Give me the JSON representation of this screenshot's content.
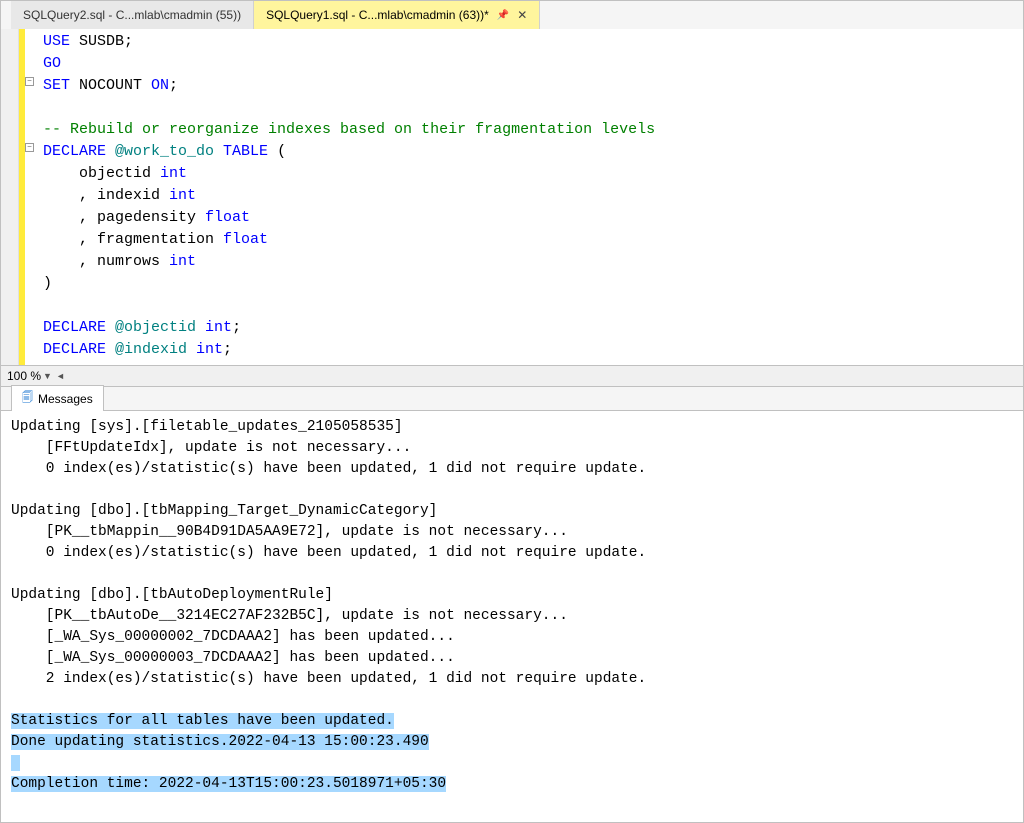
{
  "tabs": {
    "inactive": "SQLQuery2.sql - C...mlab\\cmadmin (55))",
    "active": "SQLQuery1.sql - C...mlab\\cmadmin (63))*"
  },
  "code": {
    "l1a": "USE",
    "l1b": " SUSDB",
    "l1c": ";",
    "l2": "GO",
    "l3a": "SET",
    "l3b": " NOCOUNT ",
    "l3c": "ON",
    "l3d": ";",
    "l5": "-- Rebuild or reorganize indexes based on their fragmentation levels",
    "l6a": "DECLARE",
    "l6b": " @work_to_do ",
    "l6c": "TABLE",
    "l6d": " (",
    "l7a": "    objectid ",
    "l7b": "int",
    "l8a": "    , indexid ",
    "l8b": "int",
    "l9a": "    , pagedensity ",
    "l9b": "float",
    "l10a": "    , fragmentation ",
    "l10b": "float",
    "l11a": "    , numrows ",
    "l11b": "int",
    "l12": ")",
    "l14a": "DECLARE",
    "l14b": " @objectid ",
    "l14c": "int",
    "l14d": ";",
    "l15a": "DECLARE",
    "l15b": " @indexid ",
    "l15c": "int",
    "l15d": ";"
  },
  "zoom": "100 %",
  "messages_tab": "Messages",
  "output": {
    "p1l1": "Updating [sys].[filetable_updates_2105058535]",
    "p1l2": "    [FFtUpdateIdx], update is not necessary...",
    "p1l3": "    0 index(es)/statistic(s) have been updated, 1 did not require update.",
    "p2l1": "Updating [dbo].[tbMapping_Target_DynamicCategory]",
    "p2l2": "    [PK__tbMappin__90B4D91DA5AA9E72], update is not necessary...",
    "p2l3": "    0 index(es)/statistic(s) have been updated, 1 did not require update.",
    "p3l1": "Updating [dbo].[tbAutoDeploymentRule]",
    "p3l2": "    [PK__tbAutoDe__3214EC27AF232B5C], update is not necessary...",
    "p3l3": "    [_WA_Sys_00000002_7DCDAAA2] has been updated...",
    "p3l4": "    [_WA_Sys_00000003_7DCDAAA2] has been updated...",
    "p3l5": "    2 index(es)/statistic(s) have been updated, 1 did not require update.",
    "h1": "Statistics for all tables have been updated.",
    "h2": "Done updating statistics.2022-04-13 15:00:23.490",
    "h3": " ",
    "h4": "Completion time: 2022-04-13T15:00:23.5018971+05:30"
  }
}
